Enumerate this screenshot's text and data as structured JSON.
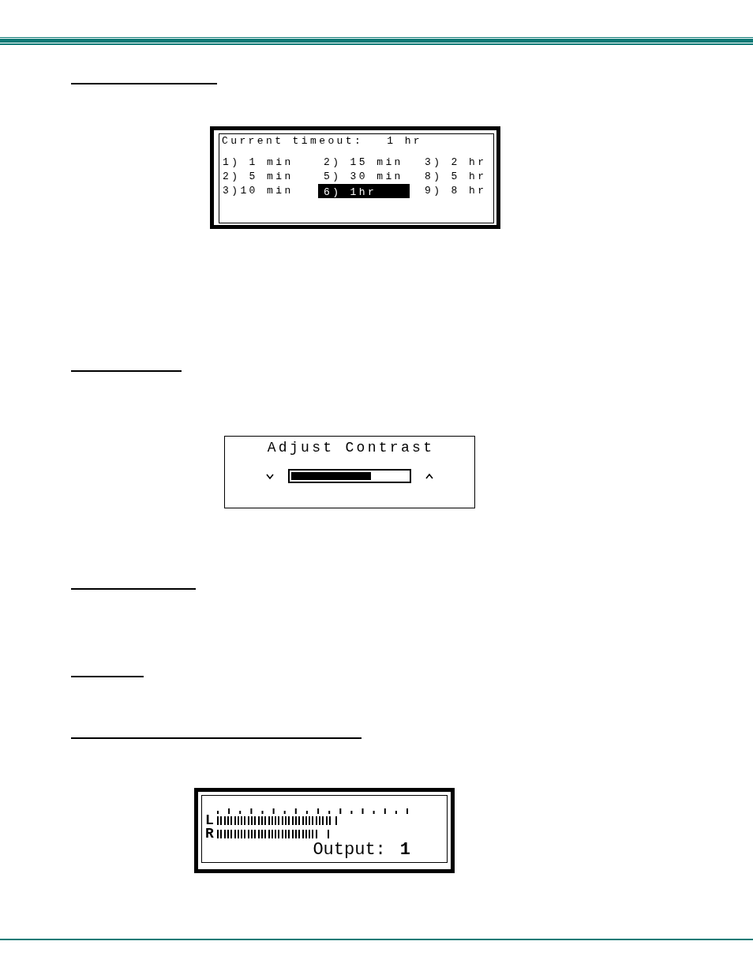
{
  "timeout_screen": {
    "title": "Current timeout:",
    "value": "1 hr",
    "options": [
      {
        "label": "1) 1 min",
        "selected": false
      },
      {
        "label": "2) 15 min",
        "selected": false
      },
      {
        "label": "3) 2 hr",
        "selected": false
      },
      {
        "label": "2) 5 min",
        "selected": false
      },
      {
        "label": "5) 30 min",
        "selected": false
      },
      {
        "label": "8) 5 hr",
        "selected": false
      },
      {
        "label": "3)10 min",
        "selected": false
      },
      {
        "label": "6) 1hr",
        "selected": true
      },
      {
        "label": "9) 8 hr",
        "selected": false
      }
    ]
  },
  "contrast_screen": {
    "title": "Adjust Contrast",
    "level": 0.68
  },
  "meter_screen": {
    "channels": [
      {
        "label": "L",
        "level": 0.6,
        "peak": {
          "level": 0.62
        }
      },
      {
        "label": "R",
        "level": 0.53,
        "peak": {
          "level": 0.58
        }
      }
    ],
    "output": {
      "label": "Output:",
      "value": "1"
    }
  }
}
